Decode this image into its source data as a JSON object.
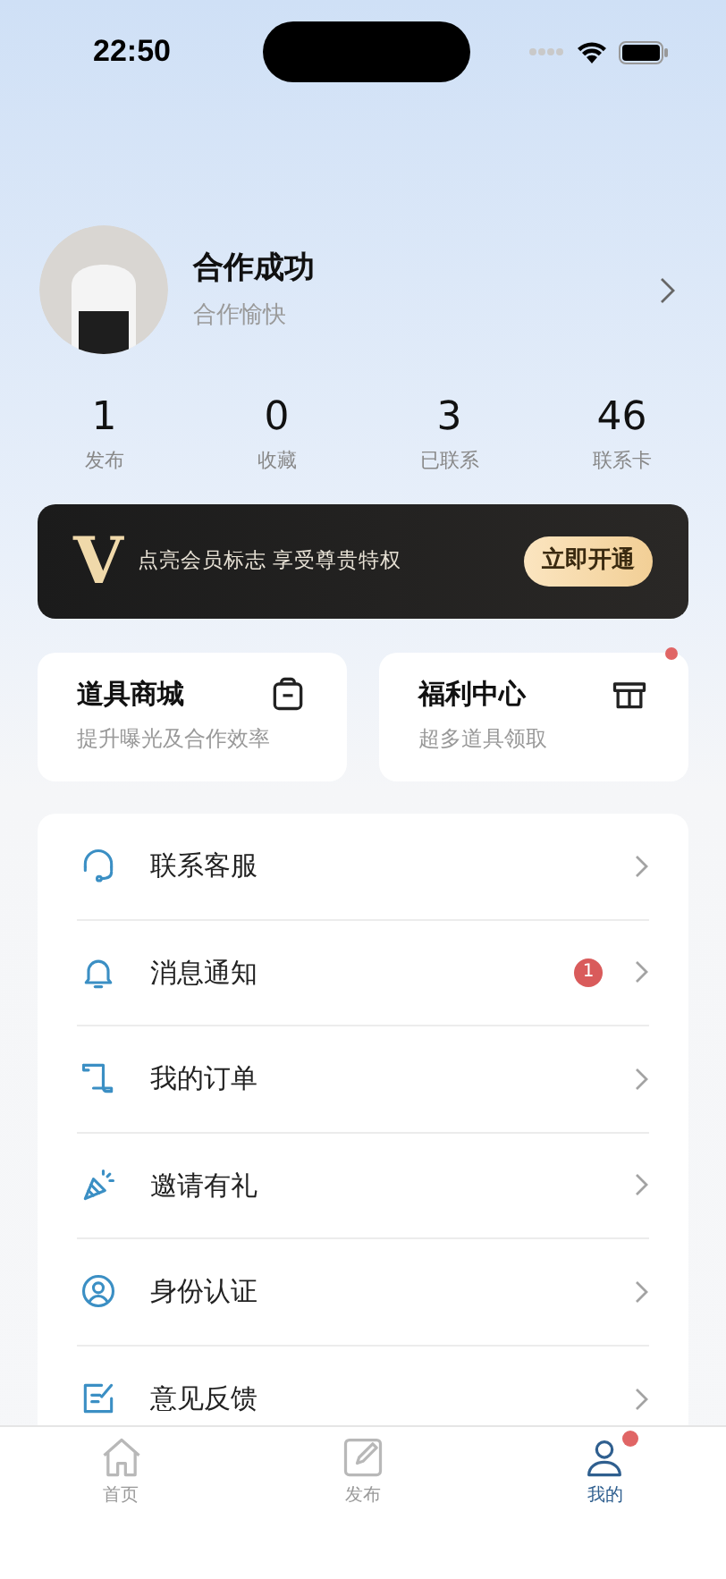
{
  "status_bar": {
    "time": "22:50"
  },
  "profile": {
    "name": "合作成功",
    "subtitle": "合作愉快"
  },
  "stats": [
    {
      "value": "1",
      "label": "发布"
    },
    {
      "value": "0",
      "label": "收藏"
    },
    {
      "value": "3",
      "label": "已联系"
    },
    {
      "value": "46",
      "label": "联系卡"
    }
  ],
  "vip_banner": {
    "logo": "V",
    "text": "点亮会员标志 享受尊贵特权",
    "button": "立即开通"
  },
  "cards": [
    {
      "kind": "bag",
      "title": "道具商城",
      "subtitle": "提升曝光及合作效率",
      "dot": false
    },
    {
      "kind": "gift",
      "title": "福利中心",
      "subtitle": "超多道具领取",
      "dot": true
    }
  ],
  "menu": [
    {
      "kind": "headset",
      "label": "联系客服"
    },
    {
      "kind": "bell",
      "label": "消息通知",
      "badge": "1"
    },
    {
      "kind": "scroll",
      "label": "我的订单"
    },
    {
      "kind": "party",
      "label": "邀请有礼"
    },
    {
      "kind": "user",
      "label": "身份认证"
    },
    {
      "kind": "feedback",
      "label": "意见反馈"
    }
  ],
  "tab_bar": [
    {
      "kind": "home",
      "label": "首页",
      "selected": false,
      "dot": false
    },
    {
      "kind": "edit",
      "label": "发布",
      "selected": false,
      "dot": false
    },
    {
      "kind": "user",
      "label": "我的",
      "selected": true,
      "dot": true
    }
  ]
}
